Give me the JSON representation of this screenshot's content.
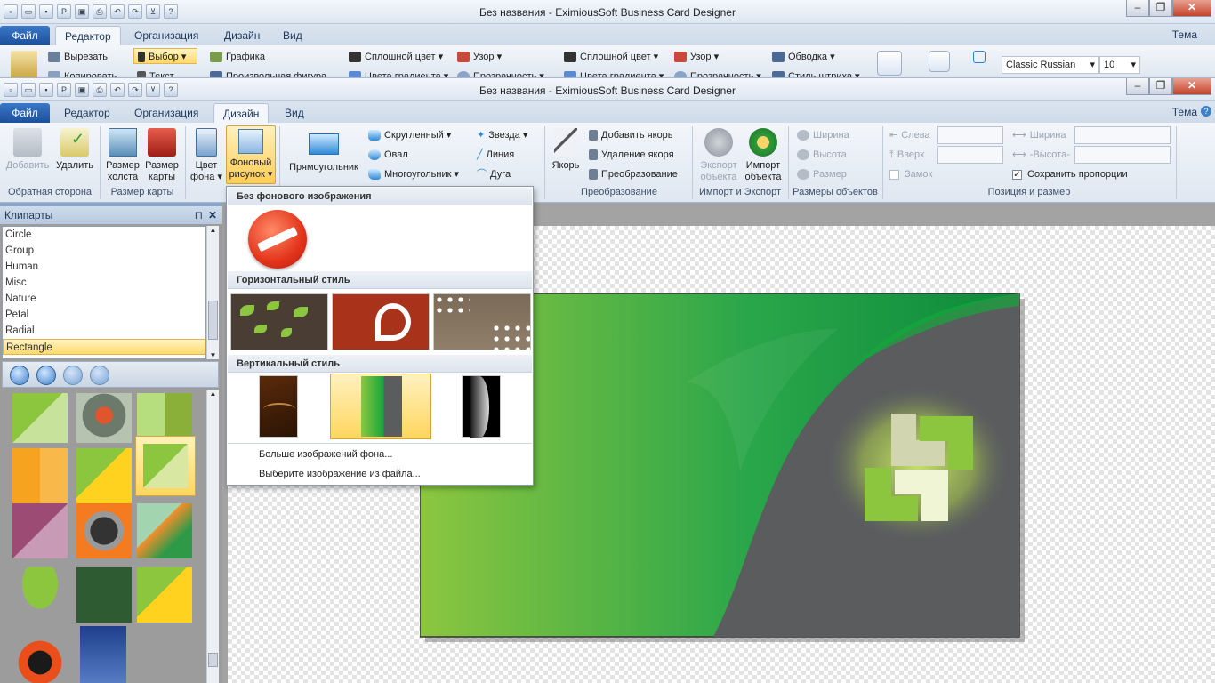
{
  "back_window": {
    "title": "Без названия - EximiousSoft Business Card Designer",
    "tabs": [
      "Файл",
      "Редактор",
      "Организация",
      "Дизайн",
      "Вид"
    ],
    "active_tab": "Редактор",
    "tema": "Тема",
    "items": {
      "cut": "Вырезать",
      "copy": "Копировать",
      "select": "Выбор",
      "text": "Текст",
      "graphics": "Графика",
      "freeform": "Произвольная фигура",
      "solid1": "Сплошной цвет",
      "gradient1": "Цвета градиента",
      "pattern1": "Узор",
      "transparency1": "Прозрачность",
      "solid2": "Сплошной цвет",
      "gradient2": "Цвета градиента",
      "pattern2": "Узор",
      "transparency2": "Прозрачность",
      "outline": "Обводка",
      "stroke_style": "Стиль штриха",
      "font": "Classic Russian",
      "font_size": "10"
    }
  },
  "window": {
    "title": "Без названия - EximiousSoft Business Card Designer",
    "tabs": [
      "Файл",
      "Редактор",
      "Организация",
      "Дизайн",
      "Вид"
    ],
    "active_tab": "Дизайн",
    "tema": "Тема"
  },
  "ribbon": {
    "add": "Добавить",
    "delete": "Удалить",
    "canvas_size": [
      "Размер",
      "холста"
    ],
    "card_size": [
      "Размер",
      "карты"
    ],
    "bg_color": [
      "Цвет",
      "фона"
    ],
    "bg_image": [
      "Фоновый",
      "рисунок"
    ],
    "rectangle": "Прямоугольник",
    "rounded": "Скругленный",
    "oval": "Овал",
    "polygon": "Многоугольник",
    "star": "Звезда",
    "line": "Линия",
    "arc": "Дуга",
    "anchor": "Якорь",
    "add_anchor": "Добавить якорь",
    "remove_anchor": "Удаление якоря",
    "transform": "Преобразование",
    "export_obj": [
      "Экспорт",
      "объекта"
    ],
    "import_obj": [
      "Импорт",
      "объекта"
    ],
    "width": "Ширина",
    "height": "Высота",
    "size": "Размер",
    "left": "Слева",
    "top": "Вверх",
    "lock": "Замок",
    "width2": "Ширина",
    "height2": "-Высота-",
    "keep_ratio": "Сохранить пропорции",
    "groups": {
      "back": "Обратная сторона",
      "card_size": "Размер карты",
      "transform": "Преобразование",
      "import_export": "Импорт и Экспорт",
      "obj_sizes": "Размеры объектов",
      "pos_size": "Позиция и размер"
    }
  },
  "clipart_panel": {
    "title": "Клипарты",
    "pin": "📌",
    "close": "✕",
    "categories": [
      "Circle",
      "Group",
      "Human",
      "Misc",
      "Nature",
      "Petal",
      "Radial",
      "Rectangle"
    ],
    "selected": "Rectangle"
  },
  "dropdown": {
    "no_bg": "Без фонового изображения",
    "horizontal": "Горизонтальный стиль",
    "vertical": "Вертикальный стиль",
    "more": "Больше изображений фона...",
    "from_file": "Выберите изображение из файла..."
  },
  "colors": {
    "accent": "#1c4f9a",
    "card_green": "#16a63c",
    "card_gray": "#5a5c5e",
    "logo_green": "#8cc63f"
  }
}
